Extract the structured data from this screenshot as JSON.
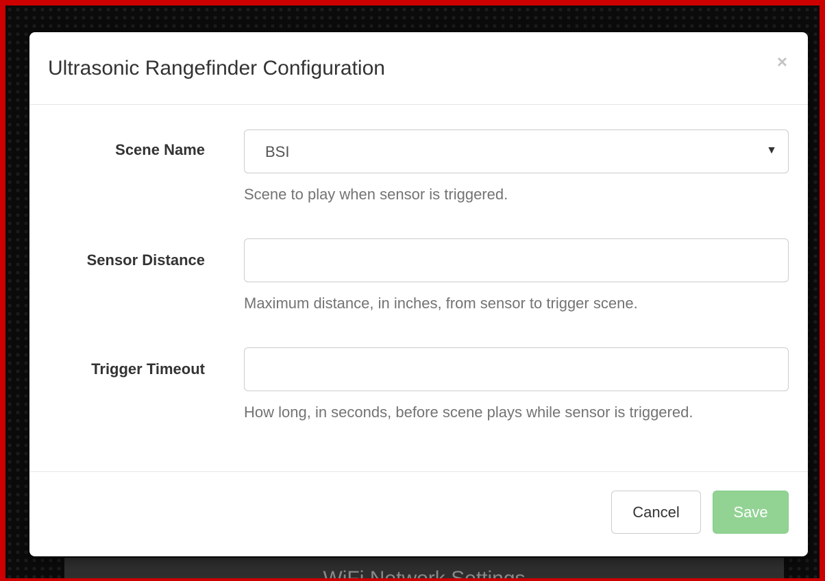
{
  "background": {
    "panel_title": "WiFi Network Settings"
  },
  "modal": {
    "title": "Ultrasonic Rangefinder Configuration",
    "close_glyph": "×"
  },
  "form": {
    "scene_name": {
      "label": "Scene Name",
      "value": "BSI",
      "help": "Scene to play when sensor is triggered."
    },
    "sensor_distance": {
      "label": "Sensor Distance",
      "value": "",
      "help": "Maximum distance, in inches, from sensor to trigger scene."
    },
    "trigger_timeout": {
      "label": "Trigger Timeout",
      "value": "",
      "help": "How long, in seconds, before scene plays while sensor is triggered."
    }
  },
  "footer": {
    "cancel_label": "Cancel",
    "save_label": "Save"
  },
  "colors": {
    "frame": "#cc0000",
    "save_button": "#92d394",
    "help_text": "#737373"
  }
}
